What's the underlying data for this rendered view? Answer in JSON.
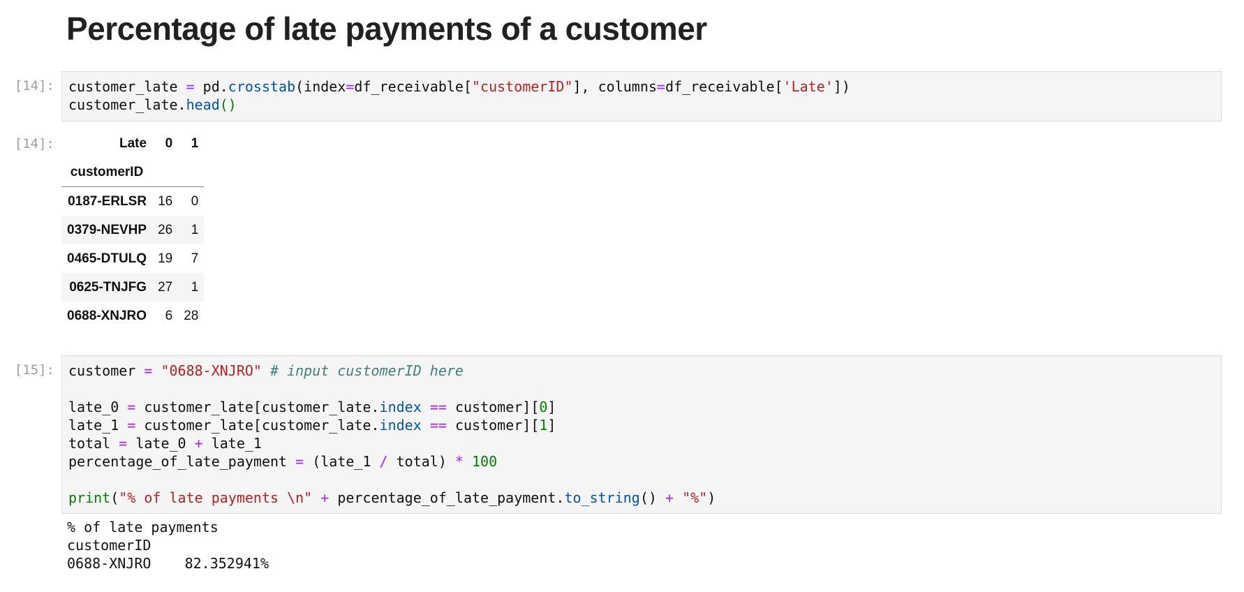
{
  "heading": "Percentage of late payments of a customer",
  "cells": [
    {
      "prompt": "[14]:",
      "code": [
        [
          [
            "",
            "customer_late "
          ],
          [
            "k",
            "="
          ],
          [
            "",
            " pd."
          ],
          [
            "f",
            "crosstab"
          ],
          [
            "",
            "(index"
          ],
          [
            "k",
            "="
          ],
          [
            "",
            "df_receivable["
          ],
          [
            "s",
            "\"customerID\""
          ],
          [
            "",
            "], columns"
          ],
          [
            "k",
            "="
          ],
          [
            "",
            "df_receivable["
          ],
          [
            "s",
            "'Late'"
          ],
          [
            "",
            "])"
          ]
        ],
        [
          [
            "",
            "customer_late."
          ],
          [
            "f",
            "head"
          ],
          [
            "p",
            "()"
          ]
        ]
      ]
    },
    {
      "prompt": "[15]:",
      "code": [
        [
          [
            "",
            "customer "
          ],
          [
            "k",
            "="
          ],
          [
            "",
            " "
          ],
          [
            "s",
            "\"0688-XNJRO\""
          ],
          [
            "",
            " "
          ],
          [
            "c",
            "# input customerID here"
          ]
        ],
        [],
        [
          [
            "",
            "late_0 "
          ],
          [
            "k",
            "="
          ],
          [
            "",
            " customer_late[customer_late."
          ],
          [
            "f",
            "index"
          ],
          [
            "",
            " "
          ],
          [
            "k",
            "=="
          ],
          [
            "",
            " customer]["
          ],
          [
            "n",
            "0"
          ],
          [
            "",
            "]"
          ]
        ],
        [
          [
            "",
            "late_1 "
          ],
          [
            "k",
            "="
          ],
          [
            "",
            " customer_late[customer_late."
          ],
          [
            "f",
            "index"
          ],
          [
            "",
            " "
          ],
          [
            "k",
            "=="
          ],
          [
            "",
            " customer]["
          ],
          [
            "n",
            "1"
          ],
          [
            "",
            "]"
          ]
        ],
        [
          [
            "",
            "total "
          ],
          [
            "k",
            "="
          ],
          [
            "",
            " late_0 "
          ],
          [
            "k",
            "+"
          ],
          [
            "",
            " late_1"
          ]
        ],
        [
          [
            "",
            "percentage_of_late_payment "
          ],
          [
            "k",
            "="
          ],
          [
            "",
            " (late_1 "
          ],
          [
            "k",
            "/"
          ],
          [
            "",
            " total) "
          ],
          [
            "k",
            "*"
          ],
          [
            "",
            " "
          ],
          [
            "n",
            "100"
          ]
        ],
        [],
        [
          [
            "n",
            "print"
          ],
          [
            "",
            "("
          ],
          [
            "s",
            "\"% of late payments \\n\""
          ],
          [
            "",
            " "
          ],
          [
            "k",
            "+"
          ],
          [
            "",
            " percentage_of_late_payment."
          ],
          [
            "f",
            "to_string"
          ],
          [
            "",
            "() "
          ],
          [
            "k",
            "+"
          ],
          [
            "",
            " "
          ],
          [
            "s",
            "\"%\""
          ],
          [
            "",
            ")"
          ]
        ]
      ]
    }
  ],
  "output_prompt": "[14]:",
  "dataframe": {
    "columns_name": "Late",
    "columns": [
      "0",
      "1"
    ],
    "index_name": "customerID",
    "rows": [
      {
        "index": "0187-ERLSR",
        "values": [
          "16",
          "0"
        ]
      },
      {
        "index": "0379-NEVHP",
        "values": [
          "26",
          "1"
        ]
      },
      {
        "index": "0465-DTULQ",
        "values": [
          "19",
          "7"
        ]
      },
      {
        "index": "0625-TNJFG",
        "values": [
          "27",
          "1"
        ]
      },
      {
        "index": "0688-XNJRO",
        "values": [
          "6",
          "28"
        ]
      }
    ]
  },
  "stdout": [
    "% of late payments",
    "customerID",
    "0688-XNJRO    82.352941%"
  ]
}
